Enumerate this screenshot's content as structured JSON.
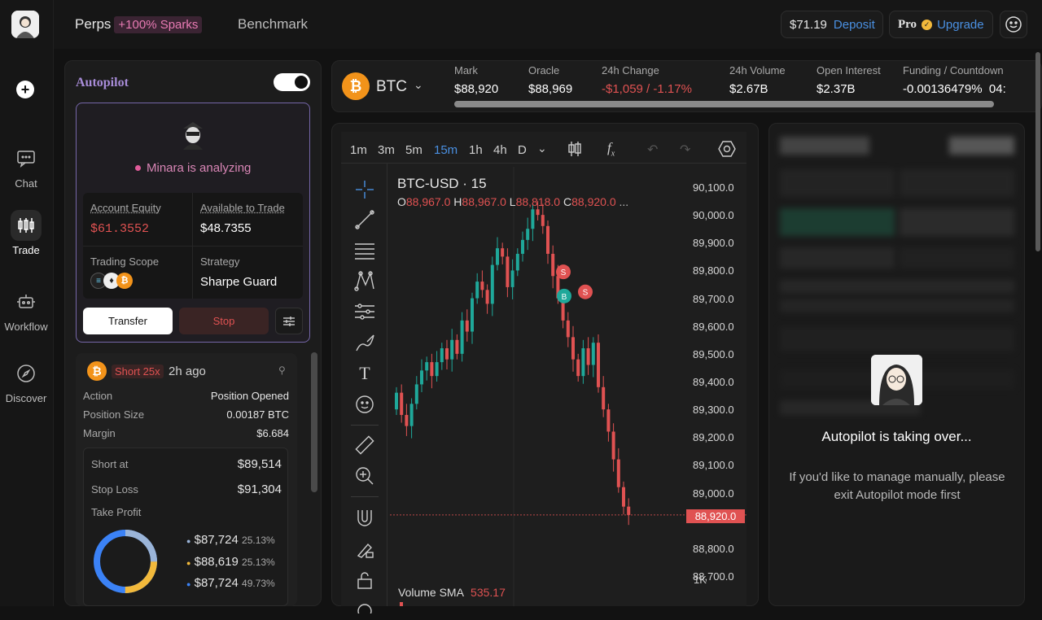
{
  "nav": {
    "items": [
      {
        "label": "Chat",
        "icon": "chat-icon"
      },
      {
        "label": "Trade",
        "icon": "candles-icon"
      },
      {
        "label": "Workflow",
        "icon": "robot-icon"
      },
      {
        "label": "Discover",
        "icon": "compass-icon"
      }
    ]
  },
  "header": {
    "tab_perps": "Perps",
    "sparks": "+100% Sparks",
    "tab_benchmark": "Benchmark",
    "balance": "$71.19",
    "deposit": "Deposit",
    "pro": "Pro",
    "upgrade": "Upgrade"
  },
  "autopilot": {
    "title": "Autopilot",
    "status": "Minara is analyzing",
    "equity_label": "Account Equity",
    "equity": "$61.3552",
    "available_label": "Available to Trade",
    "available": "$48.7355",
    "scope_label": "Trading Scope",
    "strategy_label": "Strategy",
    "strategy": "Sharpe Guard",
    "transfer": "Transfer",
    "stop": "Stop"
  },
  "position": {
    "side": "Short 25x",
    "time": "2h ago",
    "rows": [
      [
        "Action",
        "Position Opened"
      ],
      [
        "Position Size",
        "0.00187 BTC"
      ],
      [
        "Margin",
        "$6.684"
      ]
    ],
    "short_at_label": "Short at",
    "short_at": "$89,514",
    "stop_loss_label": "Stop Loss",
    "stop_loss": "$91,304",
    "tp_label": "Take Profit",
    "tps": [
      {
        "price": "$87,724",
        "pct": "25.13%",
        "color": "#9ab4d8"
      },
      {
        "price": "$88,619",
        "pct": "25.13%",
        "color": "#f2b93b"
      },
      {
        "price": "$87,724",
        "pct": "49.73%",
        "color": "#3b82f6"
      }
    ]
  },
  "market": {
    "symbol": "BTC",
    "stats": [
      {
        "label": "Mark",
        "value": "$88,920"
      },
      {
        "label": "Oracle",
        "value": "$88,969"
      },
      {
        "label": "24h Change",
        "value": "-$1,059 / -1.17%"
      },
      {
        "label": "24h Volume",
        "value": "$2.67B"
      },
      {
        "label": "Open Interest",
        "value": "$2.37B"
      },
      {
        "label": "Funding / Countdown",
        "value": "-0.00136479%  04:"
      }
    ]
  },
  "chart_toolbar": {
    "timeframes": [
      "1m",
      "3m",
      "5m",
      "15m",
      "1h",
      "4h",
      "D"
    ],
    "active": "15m"
  },
  "chart_data": {
    "type": "candlestick",
    "title": "BTC-USD · 15",
    "ohlc": {
      "o": "88,967.0",
      "h": "88,967.0",
      "l": "88,818.0",
      "c": "88,920.0"
    },
    "y_ticks": [
      "90,100.0",
      "90,000.0",
      "89,900.0",
      "89,800.0",
      "89,700.0",
      "89,600.0",
      "89,500.0",
      "89,400.0",
      "89,300.0",
      "89,200.0",
      "89,100.0",
      "89,000.0",
      "88,920.0",
      "88,800.0",
      "88,700.0"
    ],
    "ylim": [
      88700,
      90100
    ],
    "last_price": "88,920.0",
    "markers": [
      "S",
      "B",
      "S"
    ],
    "volume_label": "Volume SMA",
    "volume_value": "535.17",
    "closes": [
      89360,
      89280,
      89240,
      89320,
      89390,
      89440,
      89470,
      89420,
      89470,
      89520,
      89480,
      89550,
      89500,
      89620,
      89580,
      89700,
      89760,
      89730,
      89680,
      89820,
      89880,
      89850,
      89740,
      89800,
      89860,
      89910,
      89950,
      90020,
      90000,
      89960,
      89860,
      89780,
      89700,
      89620,
      89560,
      89480,
      89420,
      89520,
      89460,
      89540,
      89380,
      89300,
      89220,
      89120,
      89020,
      88950,
      88920
    ]
  },
  "right_panel": {
    "title": "Autopilot is taking over...",
    "message": "If you'd like to manage manually, please exit Autopilot mode first"
  }
}
